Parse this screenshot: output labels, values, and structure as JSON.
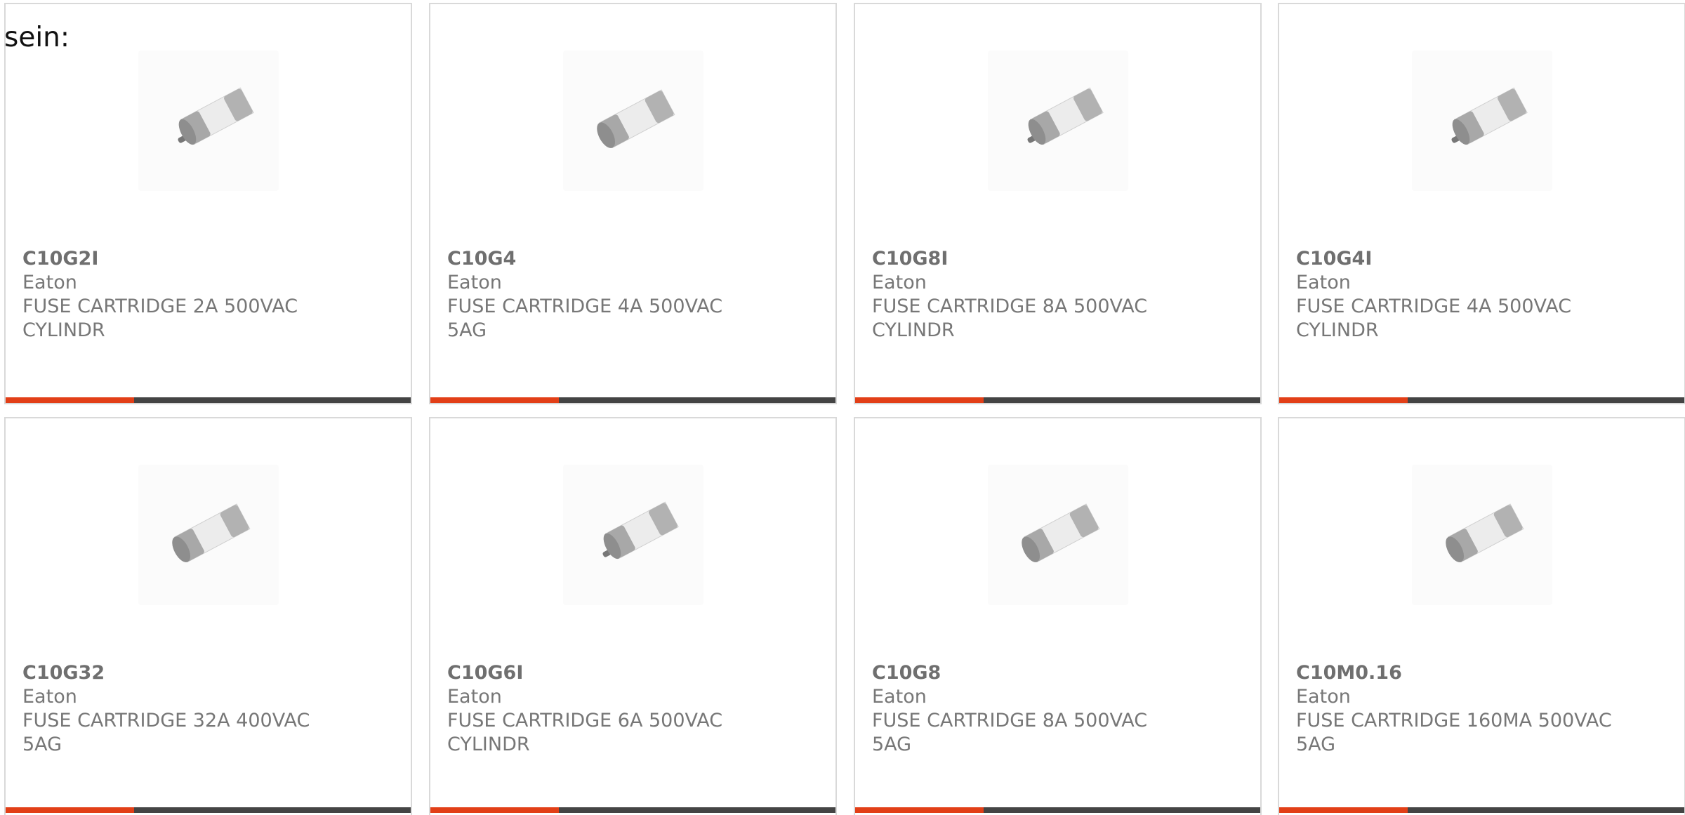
{
  "intro_text": "sein:",
  "colors": {
    "accent": "#e23f17",
    "bar": "#444444",
    "border": "#d9d9d9",
    "text": "#777777"
  },
  "products": [
    {
      "part": "C10G2I",
      "maker": "Eaton",
      "desc1": "FUSE CARTRIDGE 2A 500VAC",
      "desc2": "CYLINDR",
      "icon": "fuse-cartridge-with-pin-icon"
    },
    {
      "part": "C10G4",
      "maker": "Eaton",
      "desc1": "FUSE CARTRIDGE 4A 500VAC",
      "desc2": "5AG",
      "icon": "fuse-cartridge-icon"
    },
    {
      "part": "C10G8I",
      "maker": "Eaton",
      "desc1": "FUSE CARTRIDGE 8A 500VAC",
      "desc2": "CYLINDR",
      "icon": "fuse-cartridge-with-pin-icon"
    },
    {
      "part": "C10G4I",
      "maker": "Eaton",
      "desc1": "FUSE CARTRIDGE 4A 500VAC",
      "desc2": "CYLINDR",
      "icon": "fuse-cartridge-with-pin-icon"
    },
    {
      "part": "C10G32",
      "maker": "Eaton",
      "desc1": "FUSE CARTRIDGE 32A 400VAC",
      "desc2": "5AG",
      "icon": "fuse-cartridge-icon"
    },
    {
      "part": "C10G6I",
      "maker": "Eaton",
      "desc1": "FUSE CARTRIDGE 6A 500VAC",
      "desc2": "CYLINDR",
      "icon": "fuse-cartridge-with-pin-icon"
    },
    {
      "part": "C10G8",
      "maker": "Eaton",
      "desc1": "FUSE CARTRIDGE 8A 500VAC",
      "desc2": "5AG",
      "icon": "fuse-cartridge-icon"
    },
    {
      "part": "C10M0.16",
      "maker": "Eaton",
      "desc1": "FUSE CARTRIDGE 160MA 500VAC",
      "desc2": "5AG",
      "icon": "fuse-cartridge-icon"
    }
  ]
}
